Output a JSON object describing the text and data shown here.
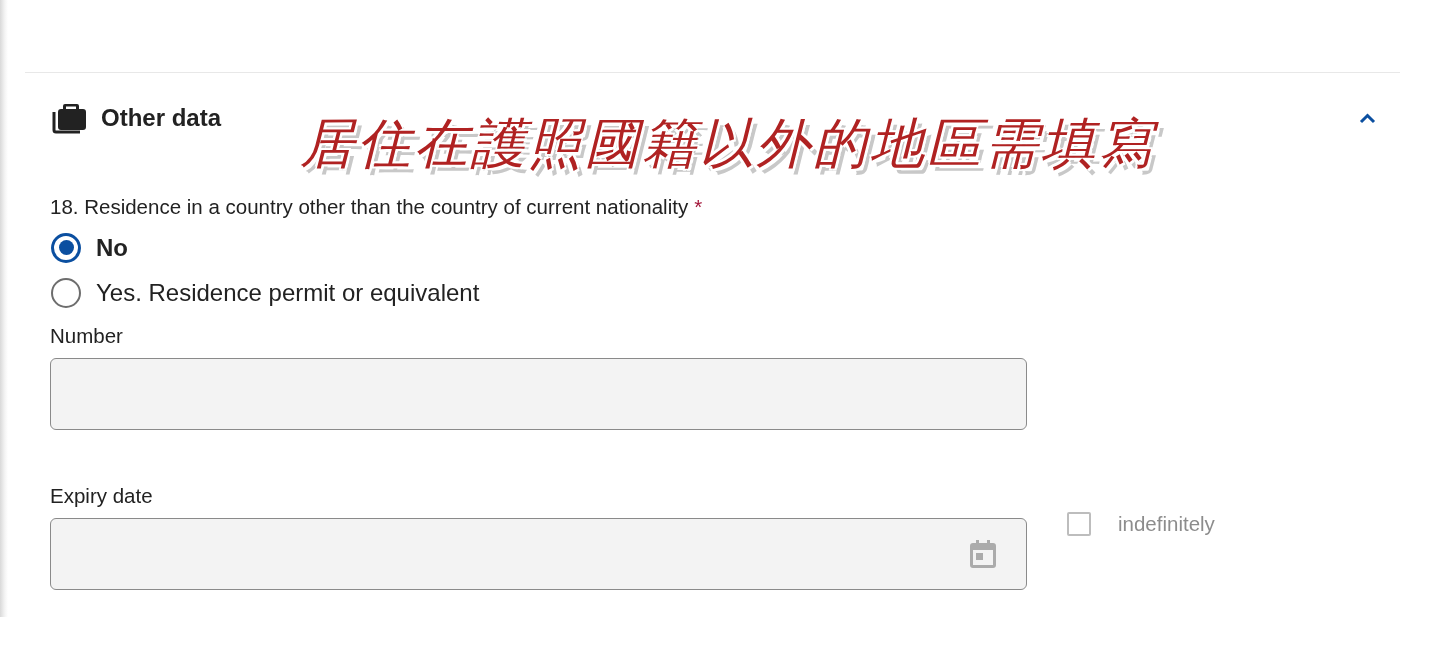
{
  "section": {
    "title": "Other data",
    "expanded": true
  },
  "annotation": {
    "text": "居住在護照國籍以外的地區需填寫"
  },
  "question": {
    "label": "18. Residence in a country other than the country of current nationality",
    "required_mark": "*",
    "options": [
      {
        "label": "No",
        "selected": true
      },
      {
        "label": "Yes. Residence permit or equivalent",
        "selected": false
      }
    ]
  },
  "fields": [
    {
      "kind": "text",
      "label": "Number",
      "disabled": true
    },
    {
      "kind": "date",
      "label": "Expiry date",
      "disabled": true,
      "checkbox": {
        "label": "indefinitely",
        "checked": false,
        "disabled": true
      }
    }
  ]
}
